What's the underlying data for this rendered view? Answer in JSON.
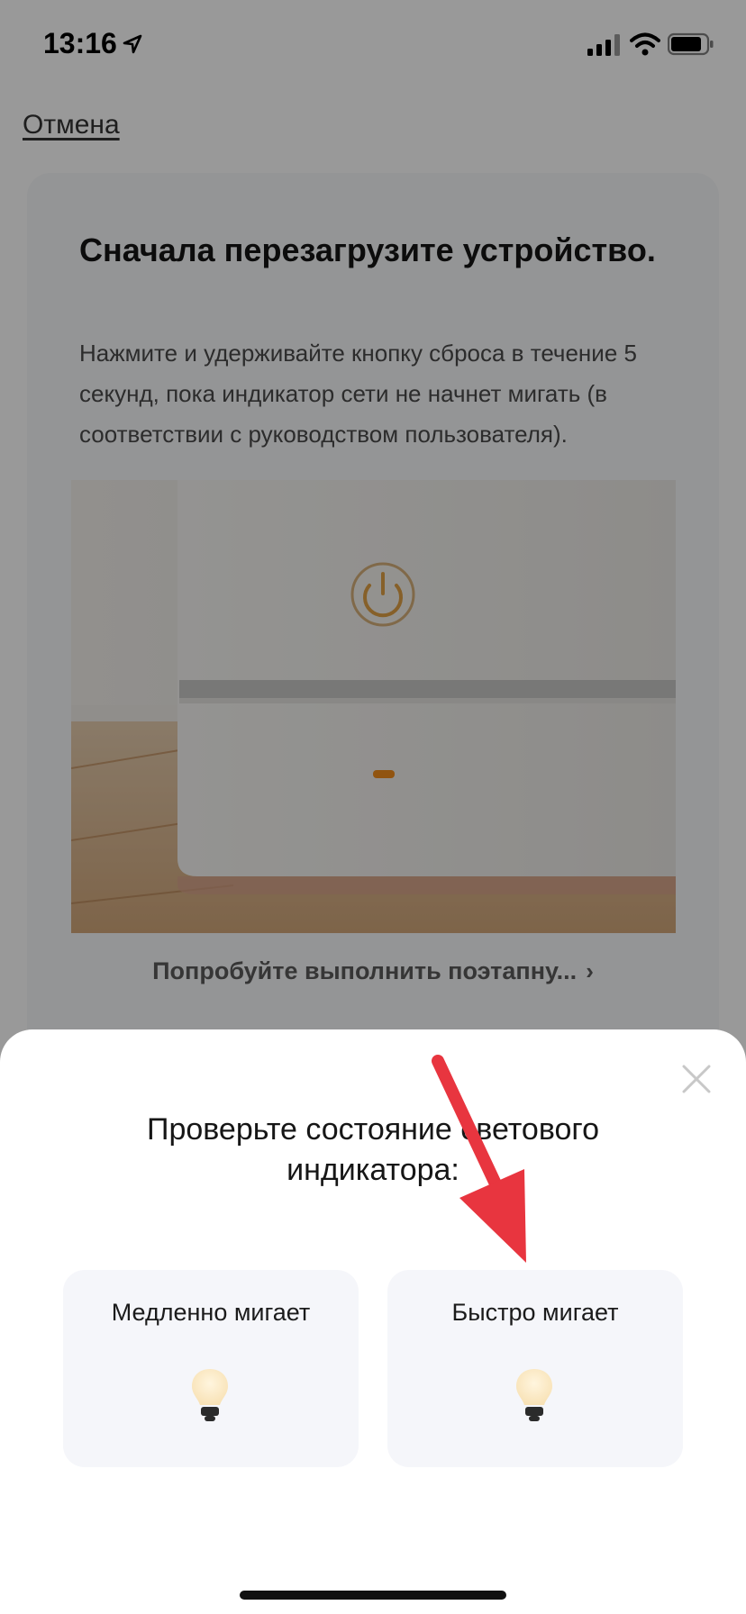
{
  "status_bar": {
    "time": "13:16"
  },
  "header": {
    "cancel_label": "Отмена"
  },
  "card": {
    "title": "Сначала перезагрузите устройство.",
    "description": "Нажмите и удерживайте кнопку сброса в течение 5 секунд, пока индикатор сети не начнет мигать  (в соответствии с руководством пользователя).",
    "link_label": "Попробуйте выполнить поэтапну...",
    "link_chevron": "›"
  },
  "sheet": {
    "title": "Проверьте состояние светового индикатора:",
    "options": [
      {
        "label": "Медленно мигает",
        "icon": "bulb-icon"
      },
      {
        "label": "Быстро мигает",
        "icon": "bulb-icon"
      }
    ],
    "close_icon": "close-icon"
  },
  "colors": {
    "overlay": "#000000",
    "annotation_arrow": "#e8353f",
    "option_background": "#f5f6fa",
    "bulb_glass": "#fbe9c6",
    "bulb_base": "#2b2b2b"
  }
}
